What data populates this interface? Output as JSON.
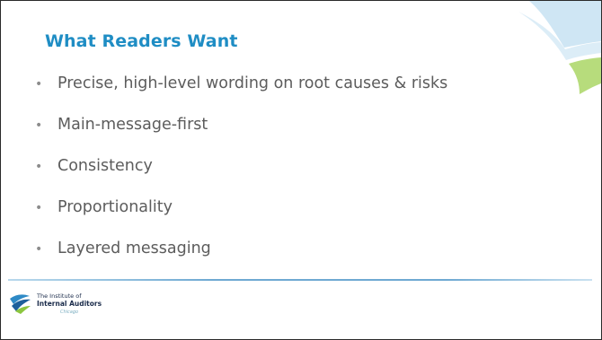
{
  "slide": {
    "title": "What Readers Want",
    "bullets": [
      {
        "text": "Precise, high-level wording on root causes & risks"
      },
      {
        "text": "Main-message-first"
      },
      {
        "text": "Consistency"
      },
      {
        "text": "Proportionality"
      },
      {
        "text": "Layered messaging"
      }
    ],
    "bullet_glyph": "•"
  },
  "footer": {
    "logo_line1": "The Institute of",
    "logo_line2": "Internal Auditors",
    "logo_line3": "Chicago",
    "logo_icon": "iia-logo-icon"
  },
  "colors": {
    "title": "#1f8dc4",
    "body_text": "#5c5c5c",
    "swoosh_blue": "#b9dcef",
    "swoosh_green": "#b7dc7c",
    "footer_rule": "#6fa9d2"
  }
}
